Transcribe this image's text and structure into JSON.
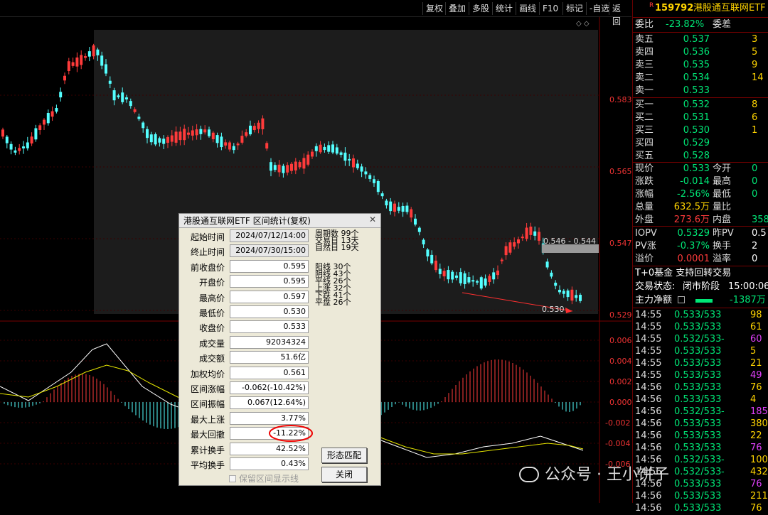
{
  "toolbar": {
    "buttons": [
      "复权",
      "叠加",
      "多股",
      "统计",
      "画线",
      "F10",
      "标记",
      "-自选",
      "返回"
    ]
  },
  "chart": {
    "price_levels": [
      "0.583",
      "0.565",
      "0.547",
      "0.529"
    ],
    "macd_levels": [
      "0.006",
      "0.004",
      "0.002",
      "0.000",
      "-0.002",
      "-0.004",
      "-0.006"
    ],
    "range_label": "0.546 - 0.544",
    "low_label": "0.530",
    "colors": {
      "up": "#ff3b3b",
      "down": "#54ffff",
      "dif": "#ffffff",
      "dea": "#e6e600"
    }
  },
  "panel": {
    "code_prefix": "R",
    "code": "159792",
    "name": "港股通互联网ETF",
    "weibi_label": "委比",
    "weibi": "-23.82%",
    "weicha_label": "委差",
    "weicha": "",
    "asks": [
      {
        "label": "卖五",
        "price": "0.537",
        "vol": "3"
      },
      {
        "label": "卖四",
        "price": "0.536",
        "vol": "5"
      },
      {
        "label": "卖三",
        "price": "0.535",
        "vol": "9"
      },
      {
        "label": "卖二",
        "price": "0.534",
        "vol": "14"
      },
      {
        "label": "卖一",
        "price": "0.533",
        "vol": ""
      }
    ],
    "bids": [
      {
        "label": "买一",
        "price": "0.532",
        "vol": "8"
      },
      {
        "label": "买二",
        "price": "0.531",
        "vol": "6"
      },
      {
        "label": "买三",
        "price": "0.530",
        "vol": "1"
      },
      {
        "label": "买四",
        "price": "0.529",
        "vol": ""
      },
      {
        "label": "买五",
        "price": "0.528",
        "vol": ""
      }
    ],
    "quotes": [
      {
        "l1": "现价",
        "v1": "0.533",
        "l2": "今开",
        "v2": "0"
      },
      {
        "l1": "涨跌",
        "v1": "-0.014",
        "l2": "最高",
        "v2": "0"
      },
      {
        "l1": "涨幅",
        "v1": "-2.56%",
        "l2": "最低",
        "v2": "0"
      },
      {
        "l1": "总量",
        "v1": "632.5万",
        "l2": "量比",
        "v2": ""
      },
      {
        "l1": "外盘",
        "v1": "273.6万",
        "l2": "内盘",
        "v2": "358"
      }
    ],
    "iopv": [
      {
        "l1": "IOPV",
        "v1": "0.5329",
        "l2": "昨PV",
        "v2": "0.5"
      },
      {
        "l1": "PV涨",
        "v1": "-0.37%",
        "l2": "换手",
        "v2": "2"
      },
      {
        "l1": "溢价",
        "v1": "0.0001",
        "l2": "溢率",
        "v2": "0"
      }
    ],
    "t0": "T+0基金 支持回转交易",
    "status_label": "交易状态:",
    "status": "闭市阶段",
    "status_time": "15:00:06",
    "main_flow_label": "主力净额",
    "main_flow": "-1387万",
    "ticks": [
      {
        "t": "14:55",
        "p": "0.533/533",
        "f": "",
        "q": "98"
      },
      {
        "t": "14:55",
        "p": "0.533/533",
        "f": "",
        "q": "61"
      },
      {
        "t": "14:55",
        "p": "0.532/533",
        "f": "-",
        "q": "60"
      },
      {
        "t": "14:55",
        "p": "0.533/533",
        "f": "",
        "q": "5"
      },
      {
        "t": "14:55",
        "p": "0.533/533",
        "f": "",
        "q": "21"
      },
      {
        "t": "14:55",
        "p": "0.533/533",
        "f": "",
        "q": "49"
      },
      {
        "t": "14:56",
        "p": "0.533/533",
        "f": "",
        "q": "76"
      },
      {
        "t": "14:56",
        "p": "0.533/533",
        "f": "",
        "q": "4"
      },
      {
        "t": "14:56",
        "p": "0.532/533",
        "f": "-",
        "q": "185"
      },
      {
        "t": "14:56",
        "p": "0.533/533",
        "f": "",
        "q": "380"
      },
      {
        "t": "14:56",
        "p": "0.533/533",
        "f": "",
        "q": "22"
      },
      {
        "t": "14:56",
        "p": "0.533/533",
        "f": "",
        "q": "76"
      },
      {
        "t": "14:56",
        "p": "0.532/533",
        "f": "-",
        "q": "100"
      },
      {
        "t": "14:56",
        "p": "0.532/533",
        "f": "-",
        "q": "432"
      },
      {
        "t": "14:56",
        "p": "0.533/533",
        "f": "",
        "q": "76"
      },
      {
        "t": "14:56",
        "p": "0.533/533",
        "f": "",
        "q": "211"
      },
      {
        "t": "14:56",
        "p": "0.533/533",
        "f": "",
        "q": "76"
      }
    ]
  },
  "dialog": {
    "title": "港股通互联网ETF 区间统计(复权)",
    "fields": [
      {
        "label": "起始时间",
        "value": "2024/07/12/14:00",
        "ro": true
      },
      {
        "label": "终止时间",
        "value": "2024/07/30/15:00",
        "ro": true
      },
      {
        "label": "前收盘价",
        "value": "0.595"
      },
      {
        "label": "开盘价",
        "value": "0.595"
      },
      {
        "label": "最高价",
        "value": "0.597"
      },
      {
        "label": "最低价",
        "value": "0.530"
      },
      {
        "label": "收盘价",
        "value": "0.533"
      },
      {
        "label": "成交量",
        "value": "92034324"
      },
      {
        "label": "成交额",
        "value": "51.6亿"
      },
      {
        "label": "加权均价",
        "value": "0.561"
      },
      {
        "label": "区间涨幅",
        "value": "-0.062(-10.42%)"
      },
      {
        "label": "区间振幅",
        "value": "0.067(12.64%)"
      },
      {
        "label": "最大上涨",
        "value": "3.77%"
      },
      {
        "label": "最大回撤",
        "value": "-11.22%"
      },
      {
        "label": "累计换手",
        "value": "42.52%"
      },
      {
        "label": "平均换手",
        "value": "0.43%"
      }
    ],
    "period_stats": [
      {
        "label": "周期数",
        "value": "99个"
      },
      {
        "label": "交易日",
        "value": "13天"
      },
      {
        "label": "自然日",
        "value": "19天"
      }
    ],
    "line_stats": [
      {
        "label": "阳线",
        "value": "30个"
      },
      {
        "label": "阴线",
        "value": "43个"
      },
      {
        "label": "平线",
        "value": "26个"
      },
      {
        "label": "上涨",
        "value": "32个"
      },
      {
        "label": "下跌",
        "value": "41个"
      },
      {
        "label": "平盘",
        "value": "26个"
      }
    ],
    "pattern_button": "形态匹配",
    "close_button": "关闭",
    "checkbox_label": "保留区间显示线"
  },
  "watermark": "公众号 · 王小饼子"
}
